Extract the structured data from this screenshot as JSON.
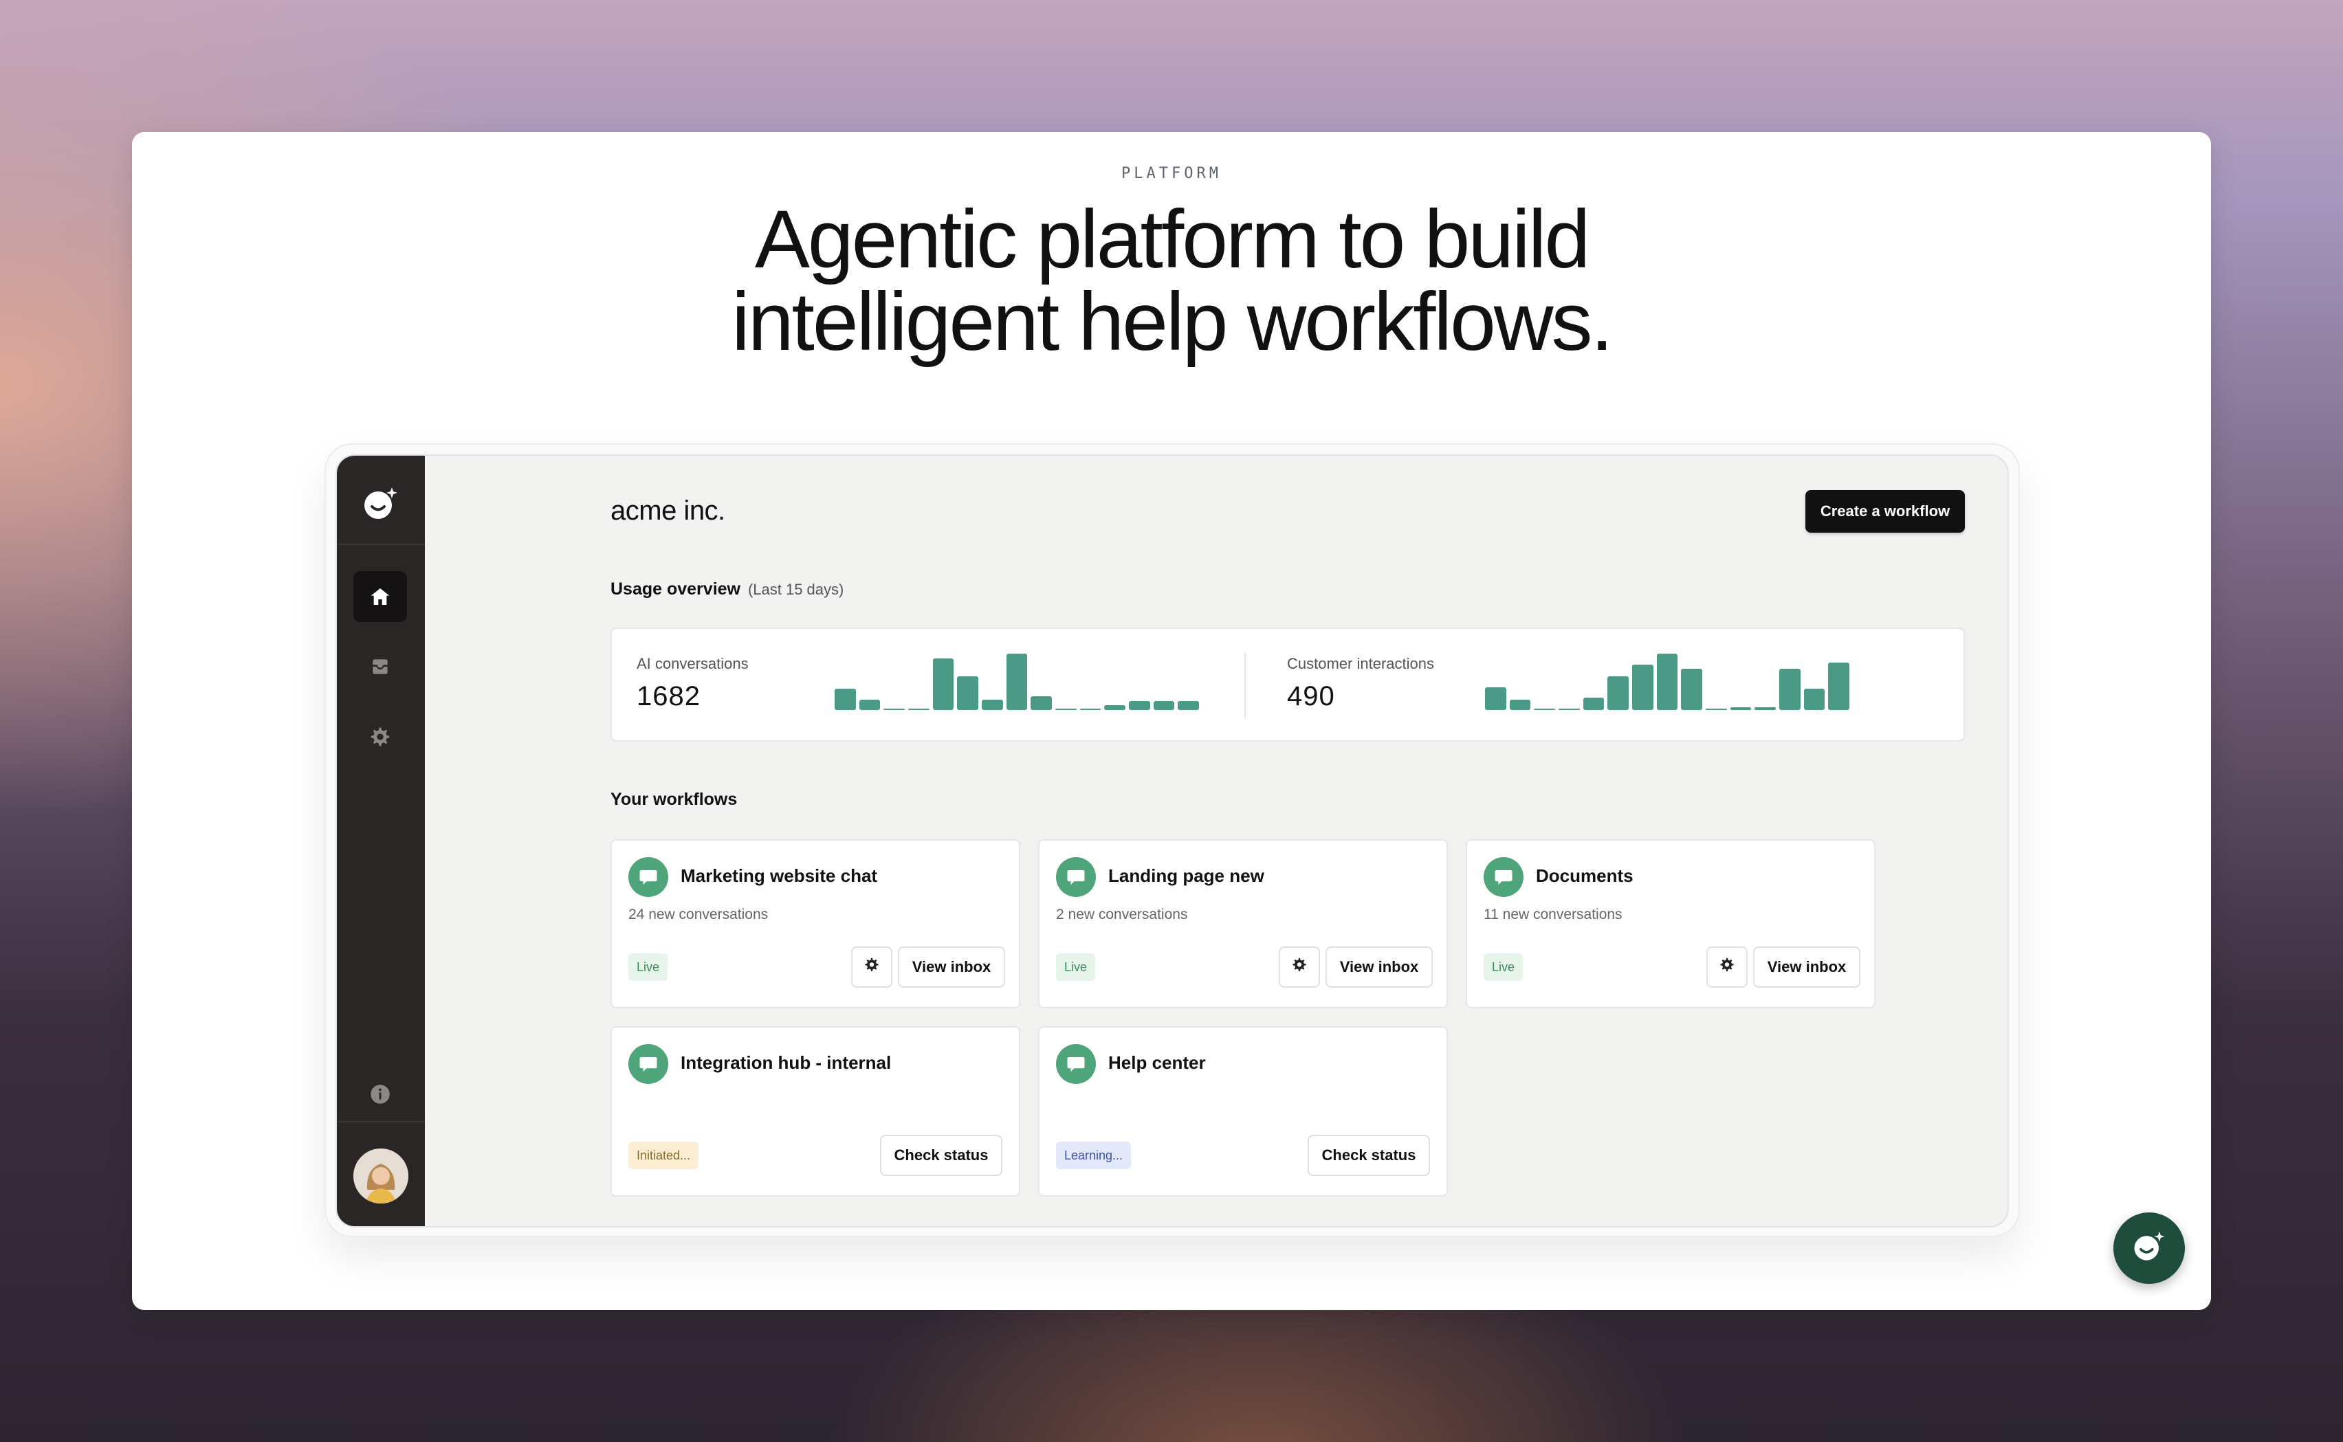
{
  "hero": {
    "eyebrow": "PLATFORM",
    "headline_line1": "Agentic platform to build",
    "headline_line2": "intelligent help workflows."
  },
  "sidebar": {
    "items": [
      {
        "icon": "home-icon",
        "active": true
      },
      {
        "icon": "inbox-icon",
        "active": false
      },
      {
        "icon": "gear-icon",
        "active": false
      }
    ],
    "bottom_icon": "info-icon"
  },
  "app": {
    "brand": "acme inc.",
    "create_button": "Create a workflow",
    "usage": {
      "title": "Usage overview",
      "period": "(Last 15 days)",
      "ai": {
        "label": "AI conversations",
        "value": "1682",
        "bars": [
          14,
          7,
          1,
          1,
          34,
          22,
          7,
          37,
          9,
          1,
          1,
          3,
          6,
          6,
          6
        ]
      },
      "customer": {
        "label": "Customer interactions",
        "value": "490",
        "bars": [
          15,
          7,
          1,
          1,
          8,
          22,
          30,
          37,
          27,
          1,
          2,
          2,
          27,
          14,
          31
        ]
      }
    },
    "workflows_title": "Your workflows",
    "workflows": [
      {
        "name": "Marketing website chat",
        "sub": "24 new conversations",
        "status": "Live",
        "status_type": "live",
        "action": "View inbox",
        "has_gear": true
      },
      {
        "name": "Landing page new",
        "sub": "2 new conversations",
        "status": "Live",
        "status_type": "live",
        "action": "View inbox",
        "has_gear": true
      },
      {
        "name": "Documents",
        "sub": "11 new conversations",
        "status": "Live",
        "status_type": "live",
        "action": "View inbox",
        "has_gear": true
      },
      {
        "name": "Integration hub - internal",
        "sub": "",
        "status": "Initiated...",
        "status_type": "initiated",
        "action": "Check status",
        "has_gear": false
      },
      {
        "name": "Help center",
        "sub": "",
        "status": "Learning...",
        "status_type": "learning",
        "action": "Check status",
        "has_gear": false
      }
    ]
  },
  "colors": {
    "accent_green": "#4a9a86",
    "chat_icon_green": "#4fa57a",
    "sidebar_dark": "#2a2626",
    "fab_green": "#1f4d3b"
  },
  "fab": {
    "icon": "chat-assistant-icon"
  }
}
